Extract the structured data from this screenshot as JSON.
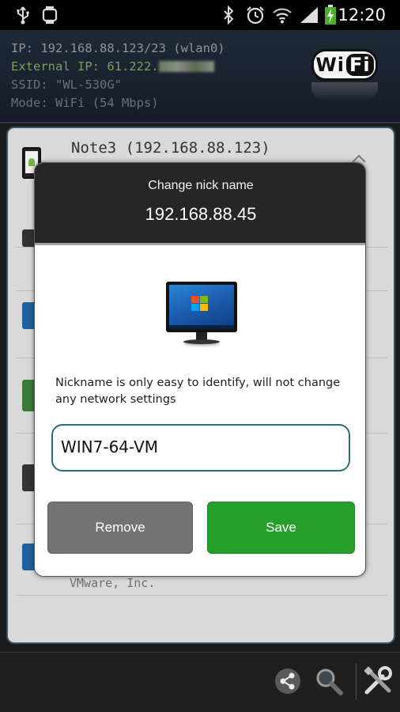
{
  "status_bar": {
    "time": "12:20",
    "icons": [
      "usb-icon",
      "watch-icon",
      "bluetooth-icon",
      "alarm-icon",
      "wifi-signal-icon",
      "cell-signal-icon",
      "battery-charging-icon"
    ]
  },
  "info_panel": {
    "ip": "IP: 192.168.88.123/23 (wlan0)",
    "external_ip_prefix": "External IP: 61.222.",
    "ssid": "SSID: \"WL-530G\"",
    "mode": "Mode: WiFi (54 Mbps)",
    "logo_left": "Wi",
    "logo_right": "Fi"
  },
  "device_list": {
    "first_item": "Note3 (192.168.88.123)",
    "last_item_vendor": "VMware, Inc."
  },
  "dialog": {
    "title": "Change nick name",
    "ip": "192.168.88.45",
    "description": "Nickname is only easy to identify, will not change any network settings",
    "nickname_value": "WIN7-64-VM",
    "remove_label": "Remove",
    "save_label": "Save"
  },
  "bottom_bar": {
    "icons": [
      "share-icon",
      "search-icon",
      "tools-icon"
    ]
  },
  "colors": {
    "save_green": "#27a02b",
    "remove_gray": "#737373",
    "input_border": "#2b6c7c",
    "dialog_header": "#262626"
  }
}
